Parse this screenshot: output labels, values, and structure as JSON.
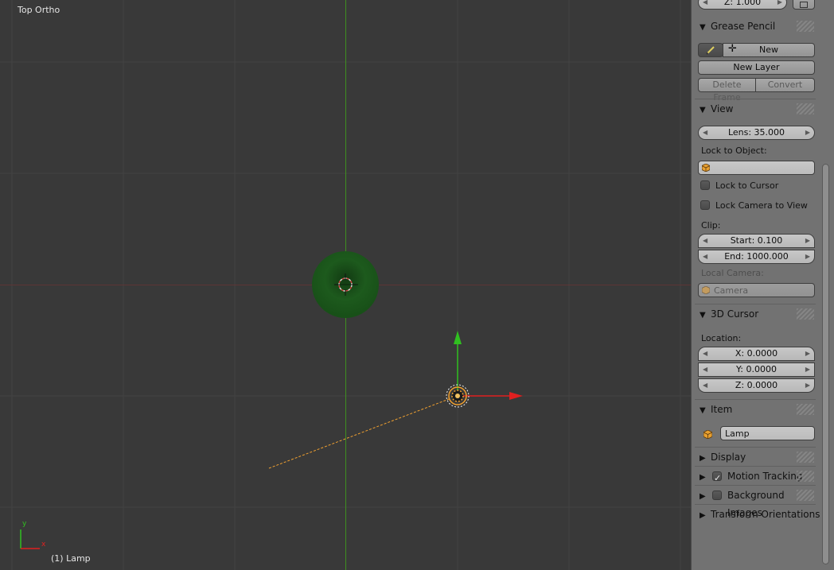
{
  "viewport": {
    "view_name": "Top Ortho",
    "status": "(1) Lamp",
    "axis_x_label": "x",
    "axis_y_label": "y"
  },
  "panel": {
    "top_field": "Z: 1.000",
    "grease_pencil": {
      "title": "Grease Pencil",
      "new_label": "New",
      "new_layer_label": "New Layer",
      "delete_frame_label": "Delete Frame",
      "convert_label": "Convert"
    },
    "view": {
      "title": "View",
      "lens": "Lens: 35.000",
      "lock_to_object_label": "Lock to Object:",
      "lock_to_cursor_label": "Lock to Cursor",
      "lock_camera_label": "Lock Camera to View",
      "clip_label": "Clip:",
      "clip_start": "Start: 0.100",
      "clip_end": "End: 1000.000",
      "local_camera_label": "Local Camera:",
      "camera_placeholder": "Camera"
    },
    "cursor_3d": {
      "title": "3D Cursor",
      "location_label": "Location:",
      "x": "X: 0.0000",
      "y": "Y: 0.0000",
      "z": "Z: 0.0000"
    },
    "item": {
      "title": "Item",
      "name": "Lamp"
    },
    "collapsed": {
      "display": "Display",
      "motion_tracking": "Motion Tracking",
      "background_images": "Background Images",
      "transform_orientations": "Transform Orientations"
    }
  },
  "colors": {
    "viewport_bg": "#393939",
    "panel_bg": "#727272",
    "y_axis_line": "#3f8f1f",
    "x_axis_line": "#6a2f2f",
    "gizmo_x": "#e02020",
    "gizmo_y": "#30c020",
    "selection": "#f0a030"
  }
}
